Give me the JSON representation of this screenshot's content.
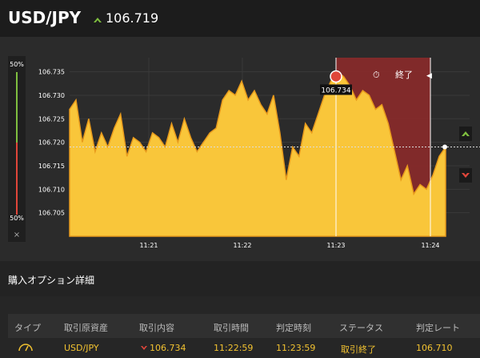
{
  "header": {
    "pair": "USD/JPY",
    "price": "106.719",
    "trend": "up"
  },
  "meter": {
    "top_label": "50%",
    "bottom_label": "50%",
    "close_symbol": "×"
  },
  "chart_data": {
    "type": "area",
    "x_ticks": [
      "11:21",
      "11:22",
      "11:23",
      "11:24"
    ],
    "y_ticks": [
      "106.735",
      "106.730",
      "106.725",
      "106.720",
      "106.715",
      "106.710",
      "106.705"
    ],
    "ylim": [
      106.7,
      106.738
    ],
    "current_rate": 106.719,
    "entry_rate": "106.734",
    "entry_time": "11:23",
    "expiry_label": "終了",
    "series": [
      106.727,
      106.729,
      106.72,
      106.725,
      106.718,
      106.722,
      106.719,
      106.723,
      106.726,
      106.717,
      106.721,
      106.72,
      106.718,
      106.722,
      106.721,
      106.719,
      106.724,
      106.72,
      106.725,
      106.721,
      106.718,
      106.72,
      106.722,
      106.723,
      106.729,
      106.731,
      106.73,
      106.733,
      106.729,
      106.731,
      106.728,
      106.726,
      106.73,
      106.722,
      106.712,
      106.719,
      106.717,
      106.724,
      106.722,
      106.726,
      106.73,
      106.733,
      106.735,
      106.734,
      106.732,
      106.729,
      106.731,
      106.73,
      106.727,
      106.728,
      106.724,
      106.718,
      106.712,
      106.715,
      106.709,
      106.711,
      106.71,
      106.713,
      106.717,
      106.719
    ]
  },
  "section": {
    "title": "購入オプション詳細"
  },
  "table": {
    "headers": [
      "タイプ",
      "取引原資産",
      "取引内容",
      "取引時間",
      "判定時刻",
      "ステータス",
      "判定レート"
    ],
    "row": {
      "asset": "USD/JPY",
      "direction": "down",
      "content": "106.734",
      "trade_time": "11:22:59",
      "judge_time": "11:23:59",
      "status": "取引終了",
      "rate": "106.710"
    }
  },
  "colors": {
    "area": "#f9c63a",
    "area_edge": "#e89a1c",
    "expired": "#8b2a2a",
    "up": "#7fbf3f",
    "down": "#e0463a"
  }
}
